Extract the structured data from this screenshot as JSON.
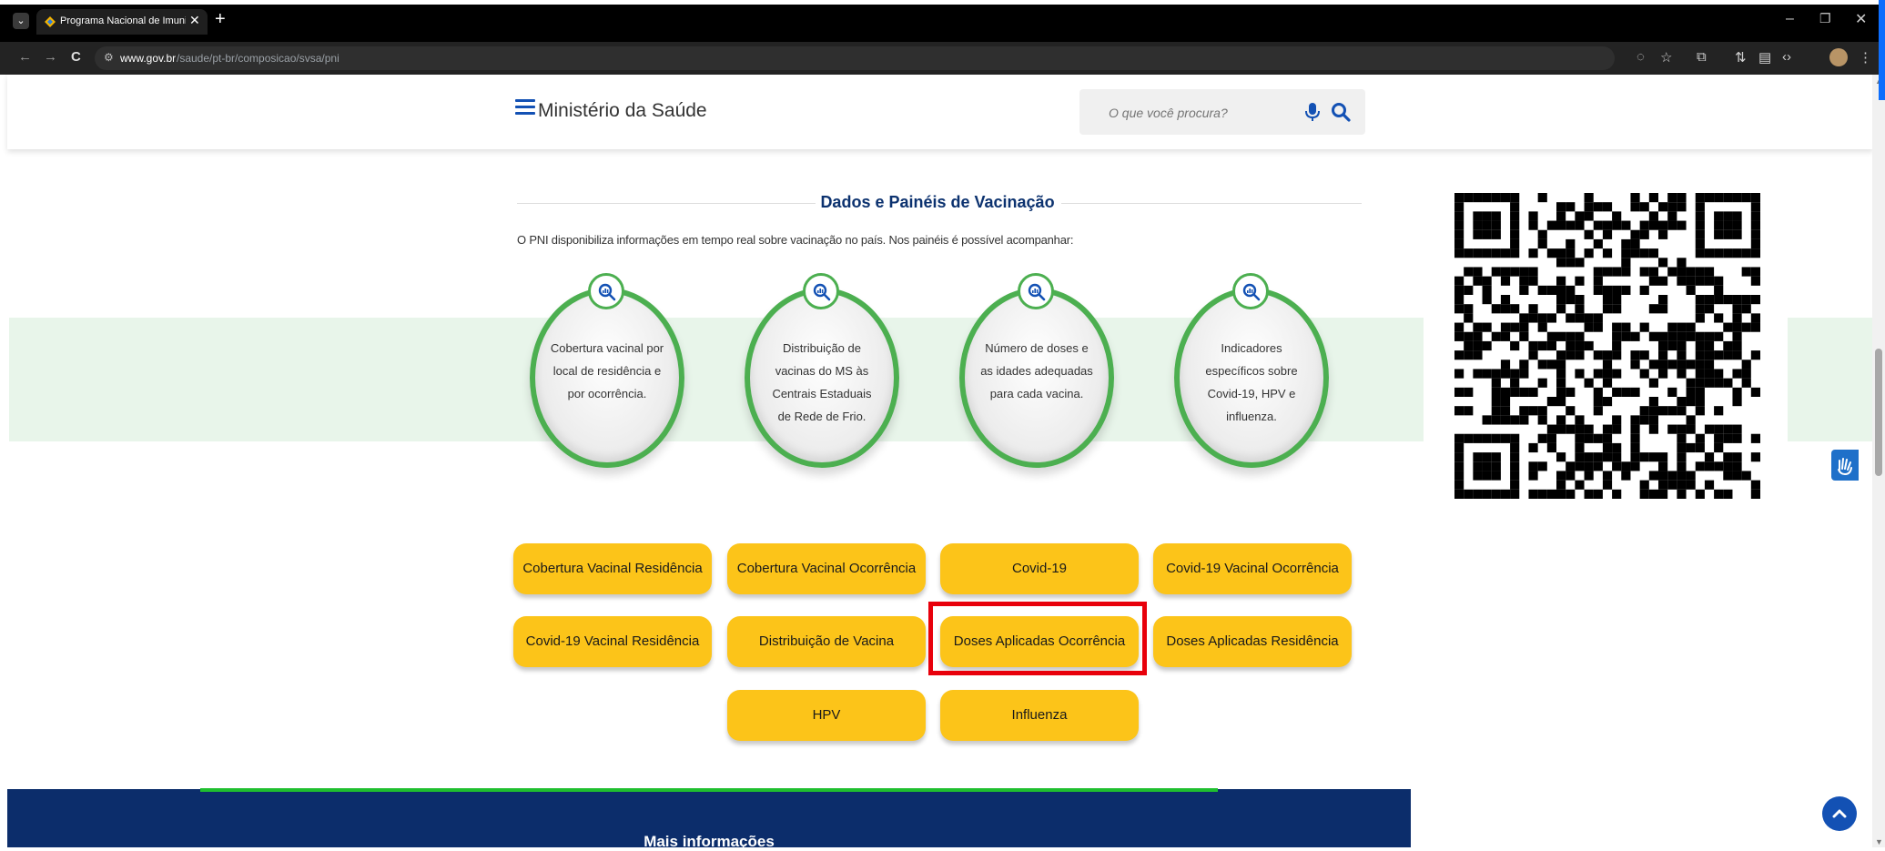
{
  "browser": {
    "tab_title": "Programa Nacional de Imunizaç",
    "tab_close": "✕",
    "new_tab": "+",
    "url_host": "www.gov.br",
    "url_path": "/saude/pt-br/composicao/svsa/pni",
    "window_controls": {
      "minimize": "–",
      "restore": "❐",
      "close": "✕"
    },
    "nav": {
      "back": "←",
      "forward": "→",
      "reload": "C"
    }
  },
  "header": {
    "site_title": "Ministério da Saúde",
    "search_placeholder": "O que você procura?"
  },
  "section": {
    "title": "Dados e Painéis de Vacinação",
    "intro": "O PNI disponibiliza informações em tempo real sobre vacinação no país. Nos painéis é possível acompanhar:"
  },
  "cards": [
    {
      "text": "Cobertura vacinal por local de residência e por ocorrência.",
      "icon": "magnifier-chart-icon"
    },
    {
      "text": "Distribuição de vacinas do MS às Centrais Estaduais de Rede de Frio.",
      "icon": "magnifier-chart-icon"
    },
    {
      "text": "Número de doses e as idades adequadas para cada vacina.",
      "icon": "magnifier-chart-icon"
    },
    {
      "text": "Indicadores específicos sobre Covid-19, HPV e influenza.",
      "icon": "magnifier-chart-icon"
    }
  ],
  "buttons": [
    "Cobertura Vacinal Residência",
    "Cobertura Vacinal Ocorrência",
    "Covid-19",
    "Covid-19 Vacinal Ocorrência",
    "Covid-19 Vacinal Residência",
    "Distribuição de Vacina",
    "Doses Aplicadas Ocorrência",
    "Doses Aplicadas Residência",
    "HPV",
    "Influenza"
  ],
  "highlighted_button": "Doses Aplicadas Ocorrência",
  "footer": {
    "title": "Mais informações"
  },
  "colors": {
    "brand_blue": "#1351b4",
    "title_navy": "#0c326f",
    "button_yellow": "#fcc419",
    "card_green": "#4caf50",
    "highlight_red": "#e8000b",
    "footer_navy": "#0c2d6b"
  }
}
